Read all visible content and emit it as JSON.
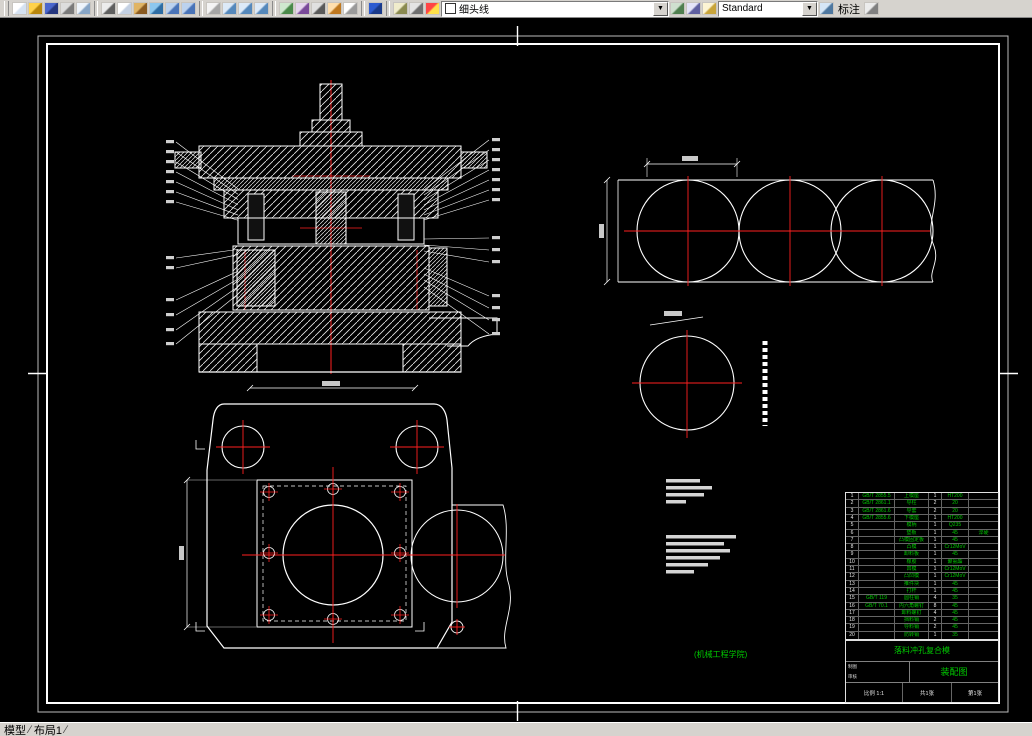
{
  "window": {
    "canvas_bg": "#000000",
    "chrome_bg": "#d6d3ce"
  },
  "toolbar": {
    "layer_combo": {
      "value": "细头线",
      "arrow": "▼"
    },
    "style_combo": {
      "value": "Standard",
      "arrow": "▼"
    },
    "dim_label": "标注",
    "icons_left": [
      {
        "name": "new-file-icon",
        "c1": "#ffffff",
        "c2": "#d5e2f2"
      },
      {
        "name": "open-folder-icon",
        "c1": "#ffd24a",
        "c2": "#b8860b"
      },
      {
        "name": "save-icon",
        "c1": "#4a66cc",
        "c2": "#25367e"
      },
      {
        "name": "plot-icon",
        "c1": "#dddddd",
        "c2": "#7a7a7a"
      },
      {
        "name": "print-preview-icon",
        "c1": "#eef4fb",
        "c2": "#87a5c6"
      },
      {
        "sep": true
      },
      {
        "name": "cut-icon",
        "c1": "#ececec",
        "c2": "#5f5f5f"
      },
      {
        "name": "copy-icon",
        "c1": "#ffffff",
        "c2": "#c3d0e2"
      },
      {
        "name": "paste-icon",
        "c1": "#e0b464",
        "c2": "#8a5a20"
      },
      {
        "name": "match-properties-icon",
        "c1": "#8cc7ee",
        "c2": "#2e6da4"
      },
      {
        "name": "undo-icon",
        "c1": "#bcd2ee",
        "c2": "#4a74b8"
      },
      {
        "name": "redo-icon",
        "c1": "#bcd2ee",
        "c2": "#4a74b8"
      },
      {
        "sep": true
      },
      {
        "name": "pan-icon",
        "c1": "#f4f4f4",
        "c2": "#a5a5a5"
      },
      {
        "name": "zoom-realtime-icon",
        "c1": "#ddeaf8",
        "c2": "#5588bb"
      },
      {
        "name": "zoom-window-icon",
        "c1": "#ddeaf8",
        "c2": "#5588bb"
      },
      {
        "name": "zoom-previous-icon",
        "c1": "#ddeaf8",
        "c2": "#5588bb"
      },
      {
        "sep": true
      },
      {
        "name": "make-block-icon",
        "c1": "#cfe8cf",
        "c2": "#4a8a4a"
      },
      {
        "name": "insert-block-icon",
        "c1": "#e6d6ee",
        "c2": "#7a4a9a"
      },
      {
        "name": "hatch-icon",
        "c1": "#e0e0e0",
        "c2": "#5a5a5a"
      },
      {
        "name": "region-icon",
        "c1": "#ffdfae",
        "c2": "#bf781f"
      },
      {
        "name": "table-icon",
        "c1": "#ffffff",
        "c2": "#9a9a9a"
      },
      {
        "sep": true
      },
      {
        "name": "help-icon",
        "c1": "#2d5bd0",
        "c2": "#1a3a8a"
      },
      {
        "sep": true
      },
      {
        "name": "layer-properties-icon",
        "c1": "#f0eccc",
        "c2": "#8a8a50"
      },
      {
        "name": "layer-previous-icon",
        "c1": "#e4e4e4",
        "c2": "#6f6f6f"
      },
      {
        "name": "color-control-icon",
        "c1": "#ff4545",
        "c2": "#ffe14a"
      }
    ],
    "icons_mid": [
      {
        "name": "properties-icon",
        "c1": "#cfe0cf",
        "c2": "#4f7f4f"
      },
      {
        "name": "layer-states-icon",
        "c1": "#e4e4f8",
        "c2": "#5f5fa0"
      },
      {
        "name": "text-style-icon",
        "c1": "#fcf4d4",
        "c2": "#c8a43a"
      }
    ],
    "icons_right1": [
      {
        "name": "dim-style-icon",
        "c1": "#d6e6f6",
        "c2": "#4f78a0"
      }
    ],
    "icons_right2": [
      {
        "name": "annotation-icon",
        "c1": "#ececec",
        "c2": "#808080"
      }
    ]
  },
  "status_tabs": {
    "separator": "∕",
    "items": [
      "模型",
      "布局1"
    ]
  },
  "drawing": {
    "colors": {
      "line": "#ffffff",
      "centerline": "#ff2020",
      "annotation_green": "#00c800"
    },
    "bom": {
      "rows": [
        [
          "1",
          "GB/T 2855.5",
          "上模座",
          "1",
          "HT200",
          ""
        ],
        [
          "2",
          "GB/T 2861.1",
          "导柱",
          "2",
          "20",
          ""
        ],
        [
          "3",
          "GB/T 2861.6",
          "导套",
          "2",
          "20",
          ""
        ],
        [
          "4",
          "GB/T 2855.6",
          "下模座",
          "1",
          "HT200",
          ""
        ],
        [
          "5",
          "",
          "模柄",
          "1",
          "Q235",
          ""
        ],
        [
          "6",
          "",
          "垫板",
          "1",
          "45",
          "淬硬"
        ],
        [
          "7",
          "",
          "凸模固定板",
          "1",
          "45",
          ""
        ],
        [
          "8",
          "",
          "凸模",
          "1",
          "Cr12MoV",
          ""
        ],
        [
          "9",
          "",
          "卸料板",
          "1",
          "45",
          ""
        ],
        [
          "10",
          "",
          "橡胶",
          "1",
          "聚氨酯",
          ""
        ],
        [
          "11",
          "",
          "凹模",
          "1",
          "Cr12MoV",
          ""
        ],
        [
          "12",
          "",
          "凸凹模",
          "1",
          "Cr12MoV",
          ""
        ],
        [
          "13",
          "",
          "推件块",
          "1",
          "45",
          ""
        ],
        [
          "14",
          "",
          "打杆",
          "1",
          "45",
          ""
        ],
        [
          "15",
          "GB/T 119",
          "圆柱销",
          "4",
          "35",
          ""
        ],
        [
          "16",
          "GB/T 70.1",
          "内六角螺钉",
          "8",
          "45",
          ""
        ],
        [
          "17",
          "",
          "卸料螺钉",
          "4",
          "45",
          ""
        ],
        [
          "18",
          "",
          "挡料销",
          "2",
          "45",
          ""
        ],
        [
          "19",
          "",
          "导料销",
          "2",
          "45",
          ""
        ],
        [
          "20",
          "",
          "防转销",
          "1",
          "35",
          ""
        ]
      ]
    },
    "titleblock": {
      "school": "(机械工程学院)",
      "title": "落料冲孔复合模",
      "subtitle": "装配图",
      "drawn_label": "制图",
      "checked_label": "审核",
      "scale": "比例 1:1",
      "sheet_total": "共1张",
      "sheet_no": "第1张"
    }
  }
}
